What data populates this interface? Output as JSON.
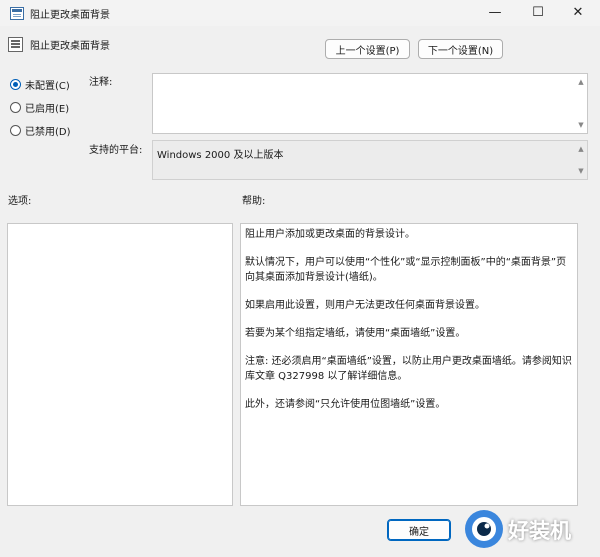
{
  "window": {
    "title": "阻止更改桌面背景",
    "controls": {
      "minimize": "—",
      "maximize": "☐",
      "close": "✕"
    }
  },
  "header": {
    "setting_title": "阻止更改桌面背景",
    "prev_button": "上一个设置(P)",
    "next_button": "下一个设置(N)"
  },
  "state_options": [
    {
      "label": "未配置(C)",
      "selected": true
    },
    {
      "label": "已启用(E)",
      "selected": false
    },
    {
      "label": "已禁用(D)",
      "selected": false
    }
  ],
  "comment": {
    "label": "注释:",
    "value": ""
  },
  "platform": {
    "label": "支持的平台:",
    "value": "Windows 2000 及以上版本"
  },
  "options": {
    "label": "选项:"
  },
  "help": {
    "label": "帮助:",
    "paragraphs": [
      "阻止用户添加或更改桌面的背景设计。",
      "默认情况下，用户可以使用“个性化”或“显示控制面板”中的“桌面背景”页向其桌面添加背景设计(墙纸)。",
      "如果启用此设置，则用户无法更改任何桌面背景设置。",
      "若要为某个组指定墙纸，请使用“桌面墙纸”设置。",
      "注意: 还必须启用“桌面墙纸”设置，以防止用户更改桌面墙纸。请参阅知识库文章 Q327998 以了解详细信息。",
      "此外，还请参阅“只允许使用位图墙纸”设置。"
    ]
  },
  "footer": {
    "ok_button": "确定"
  },
  "watermark": {
    "text": "好装机"
  },
  "colors": {
    "accent": "#005fb8",
    "window_bg": "#f0f0f0"
  },
  "icons": {
    "app": "policy-window-icon",
    "setting": "policy-setting-icon"
  }
}
